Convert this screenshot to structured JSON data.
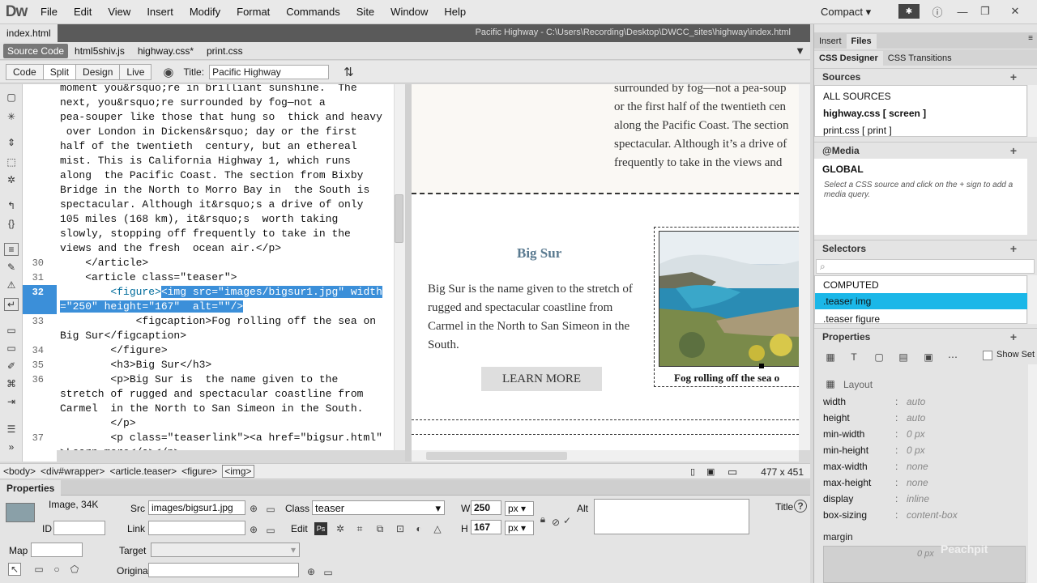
{
  "app": {
    "logo": "Dw",
    "workspace": "Compact"
  },
  "menu": [
    "File",
    "Edit",
    "View",
    "Insert",
    "Modify",
    "Format",
    "Commands",
    "Site",
    "Window",
    "Help"
  ],
  "document": {
    "tab": "index.html",
    "path": "Pacific Highway - C:\\Users\\Recording\\Desktop\\DWCC_sites\\highway\\index.html",
    "related_files": [
      "Source Code",
      "html5shiv.js",
      "highway.css*",
      "print.css"
    ]
  },
  "toolbar": {
    "code": "Code",
    "split": "Split",
    "design": "Design",
    "live": "Live",
    "title_label": "Title:",
    "title_value": "Pacific Highway"
  },
  "code": {
    "lines": [
      {
        "n": "",
        "t": "moment you&rsquo;re in brilliant sunshine.  The"
      },
      {
        "n": "",
        "t": "next, you&rsquo;re surrounded by fog—not a"
      },
      {
        "n": "",
        "t": "pea-souper like those that hung so  thick and heavy"
      },
      {
        "n": "",
        "t": " over London in Dickens&rsquo; day or the first"
      },
      {
        "n": "",
        "t": "half of the twentieth  century, but an ethereal"
      },
      {
        "n": "",
        "t": "mist. This is California Highway 1, which runs"
      },
      {
        "n": "",
        "t": "along  the Pacific Coast. The section from Bixby"
      },
      {
        "n": "",
        "t": "Bridge in the North to Morro Bay in  the South is"
      },
      {
        "n": "",
        "t": "spectacular. Although it&rsquo;s a drive of only"
      },
      {
        "n": "",
        "t": "105 miles (168 km), it&rsquo;s  worth taking"
      },
      {
        "n": "",
        "t": "slowly, stopping off frequently to take in the"
      },
      {
        "n": "",
        "t": "views and the fresh  ocean air.</p>"
      },
      {
        "n": "30",
        "t": "    </article>"
      },
      {
        "n": "31",
        "t": "    <article class=\"teaser\">"
      },
      {
        "n": "32",
        "t": "        <figure><img src=\"images/bigsur1.jpg\" width"
      },
      {
        "n": "",
        "t": "=\"250\" height=\"167\"  alt=\"\"/>"
      },
      {
        "n": "33",
        "t": "            <figcaption>Fog rolling off the sea on"
      },
      {
        "n": "",
        "t": "Big Sur</figcaption>"
      },
      {
        "n": "34",
        "t": "        </figure>"
      },
      {
        "n": "35",
        "t": "        <h3>Big Sur</h3>"
      },
      {
        "n": "36",
        "t": "        <p>Big Sur is  the name given to the"
      },
      {
        "n": "",
        "t": "stretch of rugged and spectacular coastline from"
      },
      {
        "n": "",
        "t": "Carmel  in the North to San Simeon in the South."
      },
      {
        "n": "",
        "t": "        </p>"
      },
      {
        "n": "37",
        "t": "        <p class=\"teaserlink\"><a href=\"bigsur.html\""
      },
      {
        "n": "",
        "t": ">Learn more</a></p>"
      }
    ]
  },
  "design": {
    "intro_lines": [
      "surrounded by fog—not a pea-soup",
      "or the first half of the twentieth cen",
      "along the Pacific Coast. The section",
      "spectacular. Although it’s a drive of",
      "frequently to take in the views and"
    ],
    "heading": "Big Sur",
    "para_lines": [
      "Big Sur is the name given to the stretch of",
      "rugged and spectacular coastline from",
      "Carmel in the North to San Simeon in the",
      "South."
    ],
    "button": "LEARN MORE",
    "caption": "Fog rolling off the sea o"
  },
  "status": {
    "crumbs": [
      "<body>",
      "<div#wrapper>",
      "<article.teaser>",
      "<figure>",
      "<img>"
    ],
    "dims": "477 x 451"
  },
  "properties": {
    "title": "Properties",
    "type": "Image, 34K",
    "id_label": "ID",
    "src_label": "Src",
    "src": "images/bigsur1.jpg",
    "link_label": "Link",
    "class_label": "Class",
    "class_value": "teaser",
    "edit_label": "Edit",
    "w_label": "W",
    "w": "250",
    "w_unit": "px",
    "h_label": "H",
    "h": "167",
    "h_unit": "px",
    "alt_label": "Alt",
    "title_label": "Title",
    "map_label": "Map",
    "target_label": "Target",
    "original_label": "Original"
  },
  "panel": {
    "tabs": [
      "Insert",
      "Files"
    ],
    "subtabs": [
      "CSS Designer",
      "CSS Transitions"
    ],
    "sources_label": "Sources",
    "sources": [
      "ALL SOURCES",
      "highway.css  [ screen ]",
      "print.css  [ print ]"
    ],
    "media_label": "@Media",
    "media_global": "GLOBAL",
    "media_note": "Select a CSS source and click on the + sign to add a media query.",
    "selectors_label": "Selectors",
    "selectors": [
      "COMPUTED",
      ".teaser img",
      ".teaser figure"
    ],
    "properties_label": "Properties",
    "show_set": "Show Set",
    "layout_label": "Layout",
    "props": [
      {
        "k": "width",
        "v": "auto"
      },
      {
        "k": "height",
        "v": "auto"
      },
      {
        "k": "min-width",
        "v": "0 px"
      },
      {
        "k": "min-height",
        "v": "0 px"
      },
      {
        "k": "max-width",
        "v": "none"
      },
      {
        "k": "max-height",
        "v": "none"
      },
      {
        "k": "display",
        "v": "inline"
      },
      {
        "k": "box-sizing",
        "v": "content-box"
      }
    ],
    "margin_label": "margin",
    "margin_value": "0 px",
    "watermark": "Peachpit"
  }
}
